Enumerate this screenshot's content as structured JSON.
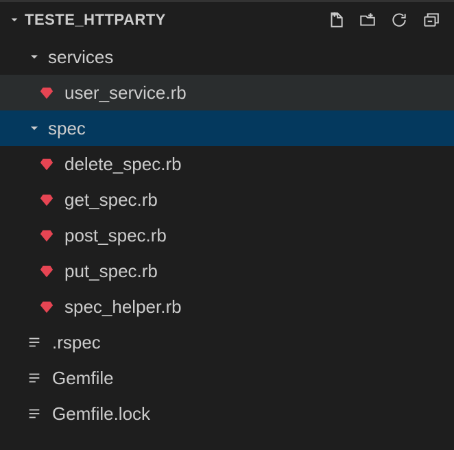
{
  "project": {
    "title": "TESTE_HTTPARTY"
  },
  "actions": {
    "newFile": "New File",
    "newFolder": "New Folder",
    "refresh": "Refresh Explorer",
    "collapse": "Collapse Folders"
  },
  "tree": {
    "folders": [
      {
        "name": "services",
        "expanded": true,
        "files": [
          {
            "name": "user_service.rb",
            "icon": "ruby",
            "highlight": true
          }
        ]
      },
      {
        "name": "spec",
        "expanded": true,
        "selected": true,
        "files": [
          {
            "name": "delete_spec.rb",
            "icon": "ruby"
          },
          {
            "name": "get_spec.rb",
            "icon": "ruby"
          },
          {
            "name": "post_spec.rb",
            "icon": "ruby"
          },
          {
            "name": "put_spec.rb",
            "icon": "ruby"
          },
          {
            "name": "spec_helper.rb",
            "icon": "ruby"
          }
        ]
      }
    ],
    "rootFiles": [
      {
        "name": ".rspec",
        "icon": "text"
      },
      {
        "name": "Gemfile",
        "icon": "text"
      },
      {
        "name": "Gemfile.lock",
        "icon": "text"
      }
    ]
  }
}
